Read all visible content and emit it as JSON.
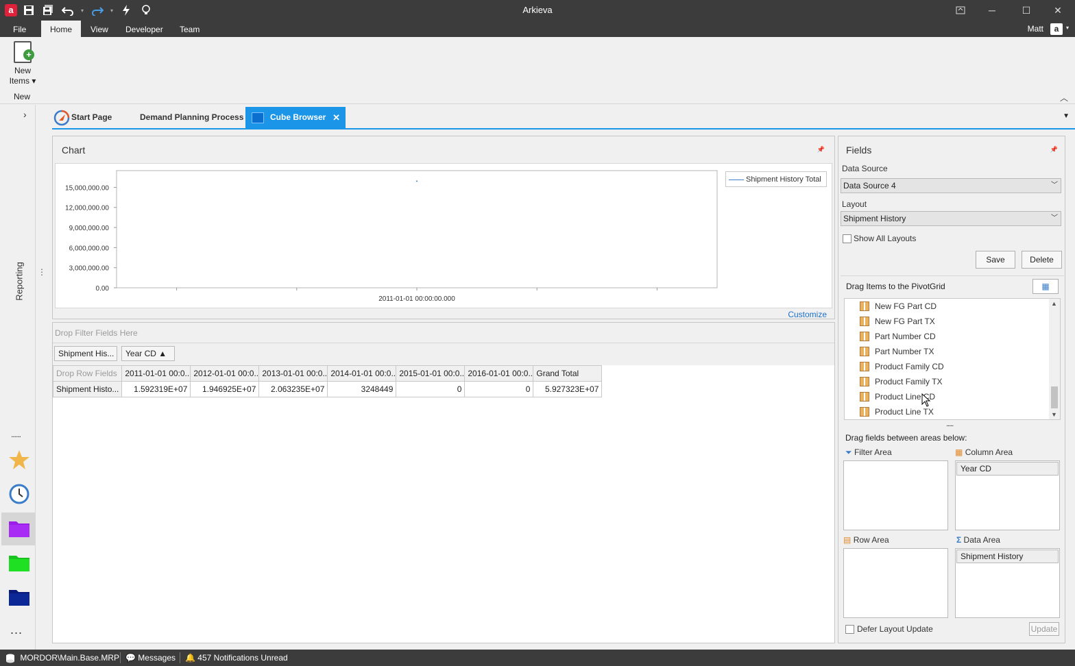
{
  "window": {
    "title": "Arkieva",
    "app_icon": "a"
  },
  "menu": {
    "items": [
      "File",
      "Home",
      "View",
      "Developer",
      "Team"
    ],
    "active": "Home",
    "user": "Matt",
    "user_icon": "a"
  },
  "ribbon": {
    "new_items_label": "New Items ▾",
    "group_new": "New"
  },
  "rail": {
    "reporting_label": "Reporting",
    "dots": "......",
    "more": "..."
  },
  "tabs": [
    "Start Page",
    "Demand Planning Process",
    "Cube Browser"
  ],
  "chart_panel": {
    "title": "Chart",
    "customize": "Customize"
  },
  "chart_data": {
    "type": "line",
    "title": "",
    "xlabel": "",
    "ylabel": "",
    "x": [
      "2011-01-01 00:00:00.000"
    ],
    "series": [
      {
        "name": "Shipment History Total",
        "values": [
          15923190
        ]
      }
    ],
    "yticks": [
      "0.00",
      "3,000,000.00",
      "6,000,000.00",
      "9,000,000.00",
      "12,000,000.00",
      "15,000,000.00"
    ],
    "ylim": [
      0,
      17500000
    ],
    "legend": "top-right",
    "color": "#3a7cc7"
  },
  "pivot": {
    "filter_placeholder": "Drop Filter Fields Here",
    "data_field_chip": "Shipment His...",
    "column_field_chip": "Year CD ▲",
    "row_placeholder": "Drop Row Fields",
    "columns": [
      "2011-01-01 00:0...",
      "2012-01-01 00:0...",
      "2013-01-01 00:0...",
      "2014-01-01 00:0...",
      "2015-01-01 00:0...",
      "2016-01-01 00:0...",
      "Grand Total"
    ],
    "rows": [
      {
        "label": "Shipment Histo...",
        "values": [
          "1.592319E+07",
          "1.946925E+07",
          "2.063235E+07",
          "3248449",
          "0",
          "0",
          "5.927323E+07"
        ]
      }
    ]
  },
  "fields": {
    "title": "Fields",
    "data_source_label": "Data Source",
    "data_source_value": "Data Source 4",
    "layout_label": "Layout",
    "layout_value": "Shipment History",
    "show_all_layouts": "Show All Layouts",
    "save": "Save",
    "delete": "Delete",
    "drag_items": "Drag Items to the PivotGrid",
    "list": [
      "New FG Part CD",
      "New FG Part TX",
      "Part Number CD",
      "Part Number TX",
      "Product Family CD",
      "Product Family TX",
      "Product Line CD",
      "Product Line TX"
    ],
    "drag_between": "Drag fields between areas below:",
    "filter_area": "Filter Area",
    "column_area": "Column Area",
    "row_area": "Row Area",
    "data_area": "Data Area",
    "column_area_item": "Year CD",
    "data_area_item": "Shipment History",
    "defer_update": "Defer Layout Update",
    "update": "Update"
  },
  "status": {
    "db": "MORDOR\\Main.Base.MRP",
    "messages": "Messages",
    "notifications": "457 Notifications Unread"
  }
}
